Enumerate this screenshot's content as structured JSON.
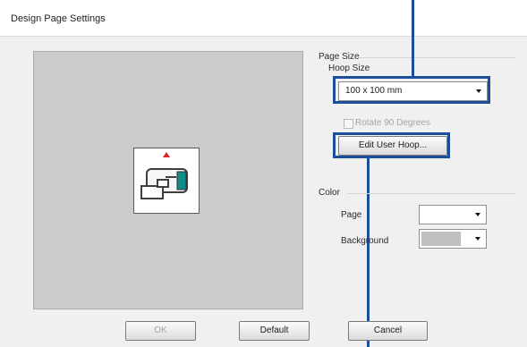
{
  "window": {
    "title": "Design Page Settings"
  },
  "page_size": {
    "label": "Page Size",
    "hoop_size": {
      "label": "Hoop Size",
      "value": "100 x 100 mm"
    },
    "rotate": {
      "label": "Rotate 90 Degrees",
      "checked": false
    },
    "edit_user_hoop": "Edit User Hoop..."
  },
  "color": {
    "label": "Color",
    "page": {
      "label": "Page",
      "swatch": "#ffffff"
    },
    "background": {
      "label": "Background",
      "swatch": "#bfbfbf"
    }
  },
  "buttons": {
    "ok": "OK",
    "default": "Default",
    "cancel": "Cancel"
  },
  "colors": {
    "highlight": "#1d4e9a",
    "preview_bg": "#cbcbcb"
  },
  "icons": [
    "hoop-sewing-machine-icon",
    "dropdown-arrow-icon"
  ]
}
